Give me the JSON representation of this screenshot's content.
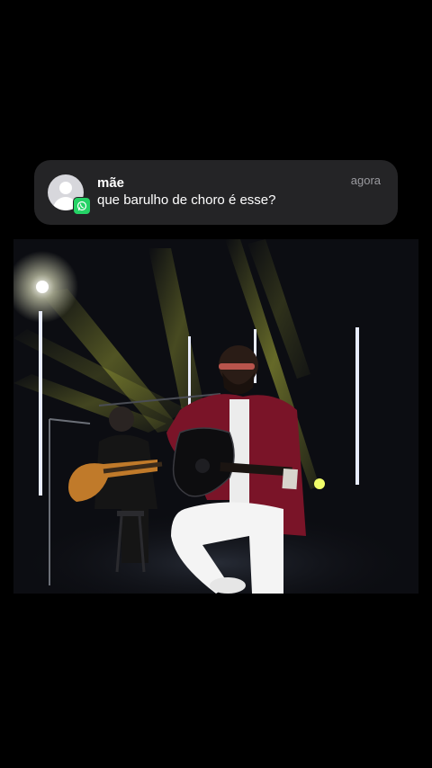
{
  "notification": {
    "sender": "mãe",
    "message": "que barulho de choro é esse?",
    "time": "agora",
    "app_icon": "whatsapp-icon",
    "avatar_icon": "person-placeholder-icon"
  },
  "video": {
    "description_icon": "video-frame"
  },
  "colors": {
    "notification_bg": "#242426",
    "whatsapp_green": "#25d366",
    "stage_light": "#e8f04a"
  }
}
